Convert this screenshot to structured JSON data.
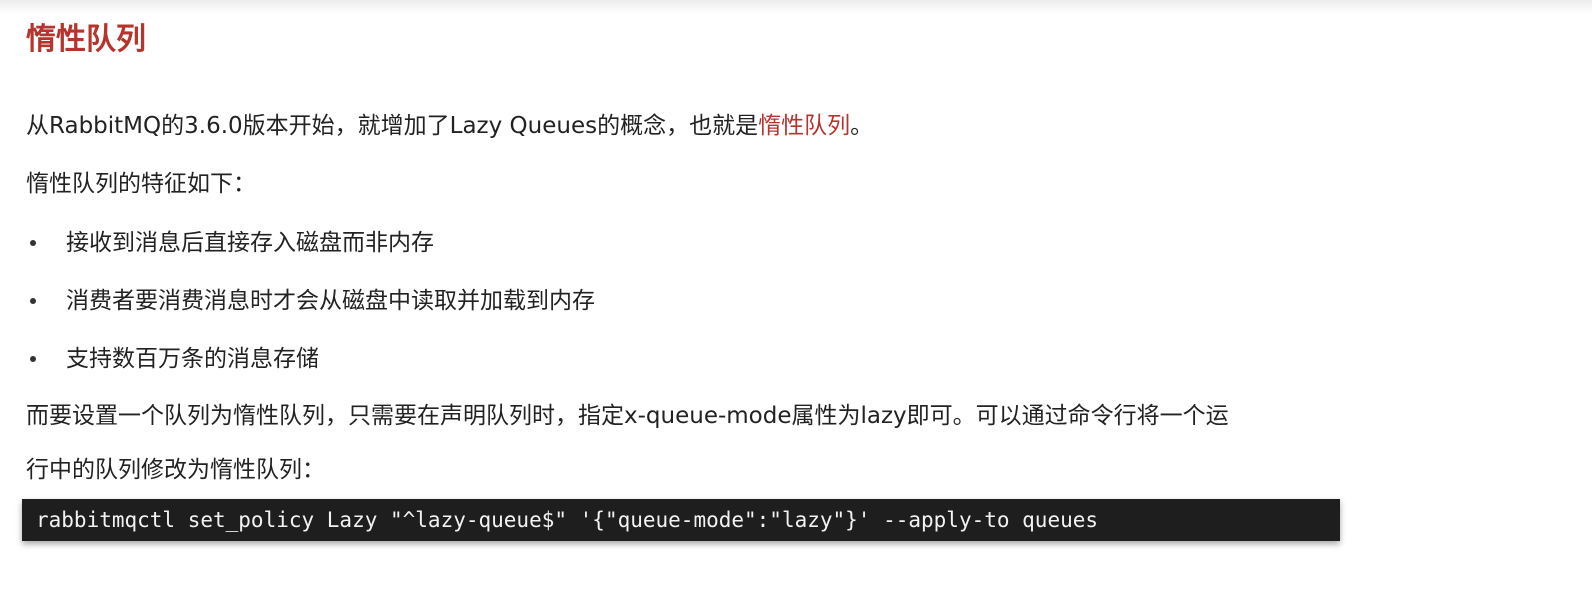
{
  "title": "惰性队列",
  "intro": {
    "before": "从RabbitMQ的3.6.0版本开始，就增加了Lazy Queues的概念，也就是",
    "highlight": "惰性队列",
    "after": "。"
  },
  "features_heading": "惰性队列的特征如下：",
  "bullets": [
    "接收到消息后直接存入磁盘而非内存",
    "消费者要消费消息时才会从磁盘中读取并加载到内存",
    "支持数百万条的消息存储"
  ],
  "setting_text": {
    "line1": "而要设置一个队列为惰性队列，只需要在声明队列时，指定x-queue-mode属性为lazy即可。可以通过命令行将一个运",
    "line2": "行中的队列修改为惰性队列："
  },
  "code": "rabbitmqctl set_policy Lazy \"^lazy-queue$\" '{\"queue-mode\":\"lazy\"}' --apply-to queues",
  "colors": {
    "accent": "#b5352e",
    "text": "#222222",
    "code_bg": "#1e1e1e",
    "code_text": "#f2f2f2"
  }
}
